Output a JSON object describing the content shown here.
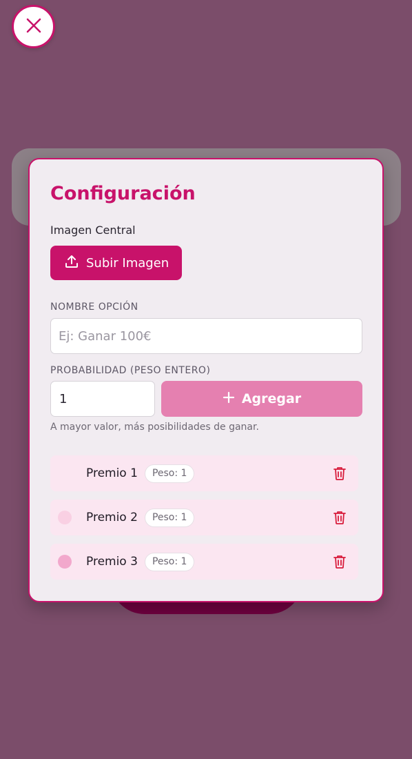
{
  "modal": {
    "title": "Configuración",
    "image_section_label": "Imagen Central",
    "upload_button_label": "Subir Imagen",
    "name_label": "NOMBRE OPCIÓN",
    "name_placeholder": "Ej: Ganar 100€",
    "weight_label": "PROBABILIDAD (PESO ENTERO)",
    "weight_value": "1",
    "add_button_label": "Agregar",
    "hint": "A mayor valor, más posibilidades de ganar."
  },
  "prizes": [
    {
      "name": "Premio 1",
      "weight": "Peso: 1",
      "color": "#fbe6f1"
    },
    {
      "name": "Premio 2",
      "weight": "Peso: 1",
      "color": "#f9d0e3"
    },
    {
      "name": "Premio 3",
      "weight": "Peso: 1",
      "color": "#f2a8cc"
    }
  ],
  "colors": {
    "accent": "#c8126a",
    "accent_light": "#e580b0",
    "overlay": "#7b4d6a",
    "delete": "#d81b3b"
  },
  "icons": {
    "close": "close-icon",
    "upload": "upload-icon",
    "plus": "plus-icon",
    "delete": "trash-icon"
  }
}
